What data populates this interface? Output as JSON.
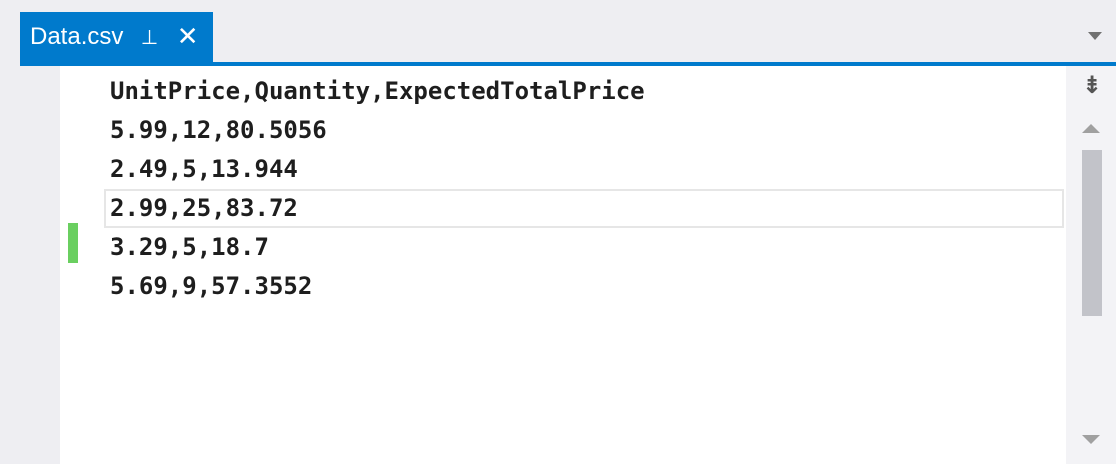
{
  "tab": {
    "title": "Data.csv",
    "pin_glyph": "⊣",
    "close_glyph": "✕"
  },
  "scrollbar": {
    "split_glyph": "⇟"
  },
  "editor": {
    "lines": [
      "UnitPrice,Quantity,ExpectedTotalPrice",
      "5.99,12,80.5056",
      "2.49,5,13.944",
      "2.99,25,83.72",
      "3.29,5,18.7",
      "5.69,9,57.3552"
    ],
    "current_line": 4,
    "changed_line": 5
  },
  "colors": {
    "accent": "#007acc",
    "change_marker": "#6acf60",
    "editor_bg": "#ffffff",
    "chrome_bg": "#eeeef2"
  }
}
